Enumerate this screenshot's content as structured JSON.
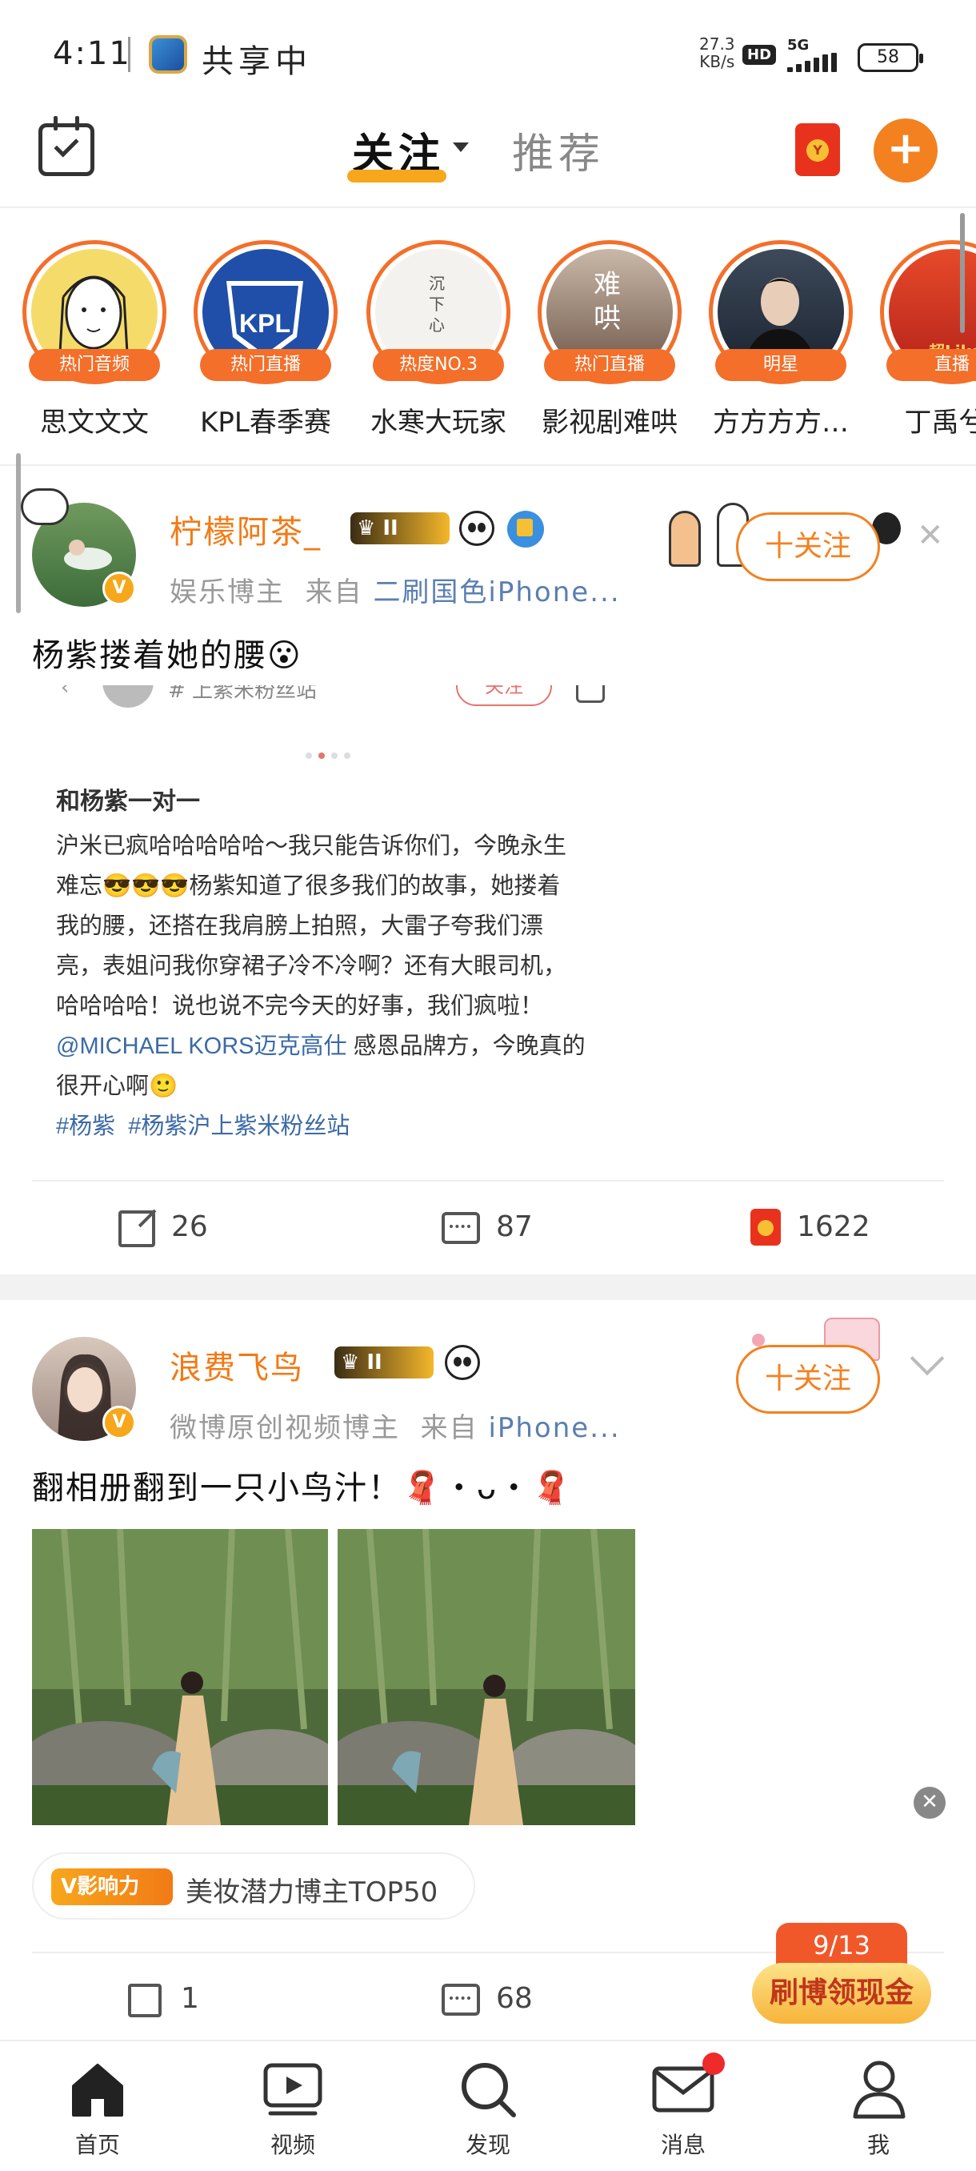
{
  "status_bar": {
    "time": "4:11",
    "sharing": "共享中",
    "speed": "27.3",
    "speed_unit": "KB/s",
    "hd": "HD",
    "network": "5G",
    "battery": "58"
  },
  "header": {
    "tab_follow": "关注",
    "tab_recommend": "推荐",
    "accent_color": "#f38120"
  },
  "stories": [
    {
      "name": "思文文文",
      "badge": "热门音频"
    },
    {
      "name": "KPL春季赛",
      "badge": "热门直播",
      "logo": "KPL"
    },
    {
      "name": "水寒大玩家",
      "badge": "热度NO.3",
      "art": "沉下心"
    },
    {
      "name": "影视剧难哄",
      "badge": "热门直播",
      "art": "难哄"
    },
    {
      "name": "方方方方…",
      "badge": "明星"
    },
    {
      "name": "丁禹兮_",
      "badge": "直播",
      "art": "超Like"
    }
  ],
  "post1": {
    "username": "柠檬阿茶_",
    "level": "II",
    "meta_role": "娱乐博主",
    "meta_from": "来自",
    "meta_source": "二刷国色iPhone...",
    "follow_label": "十关注",
    "text": "杨紫搂着她的腰",
    "emoji": "😮",
    "embed": {
      "header_partial": "# 上紫米粉丝站",
      "header_btn": "关注",
      "title": "和杨紫一对一",
      "lines": [
        "沪米已疯哈哈哈哈哈～我只能告诉你们，今晚永生",
        "难忘😎😎😎杨紫知道了很多我们的故事，她搂着",
        "我的腰，还搭在我肩膀上拍照，大雷子夸我们漂",
        "亮，表姐问我你穿裙子冷不冷啊？还有大眼司机，",
        "哈哈哈哈！说也说不完今天的好事，我们疯啦！"
      ],
      "mention": "@MICHAEL KORS迈克高仕",
      "mention_rest": " 感恩品牌方，今晚真的",
      "last_line": "很开心啊🙂",
      "tag1": "#杨紫",
      "tag2": "#杨紫沪上紫米粉丝站"
    },
    "reposts": "26",
    "comments": "87",
    "likes": "1622"
  },
  "post2": {
    "username": "浪费飞鸟",
    "level": "II",
    "meta_role": "微博原创视频博主",
    "meta_from": "来自",
    "meta_source": "iPhone...",
    "follow_label": "十关注",
    "text": "翻相册翻到一只小鸟汁！🧣・ᴗ・🧣",
    "influence_badge": "影响力",
    "influence_text": "美妆潜力博主TOP50",
    "reposts": "1",
    "comments": "68"
  },
  "task": {
    "progress": "9/13",
    "label": "刷博领现金"
  },
  "nav": [
    {
      "label": "首页",
      "icon": "home-icon"
    },
    {
      "label": "视频",
      "icon": "video-icon"
    },
    {
      "label": "发现",
      "icon": "discover-icon"
    },
    {
      "label": "消息",
      "icon": "message-icon"
    },
    {
      "label": "我",
      "icon": "profile-icon"
    }
  ]
}
